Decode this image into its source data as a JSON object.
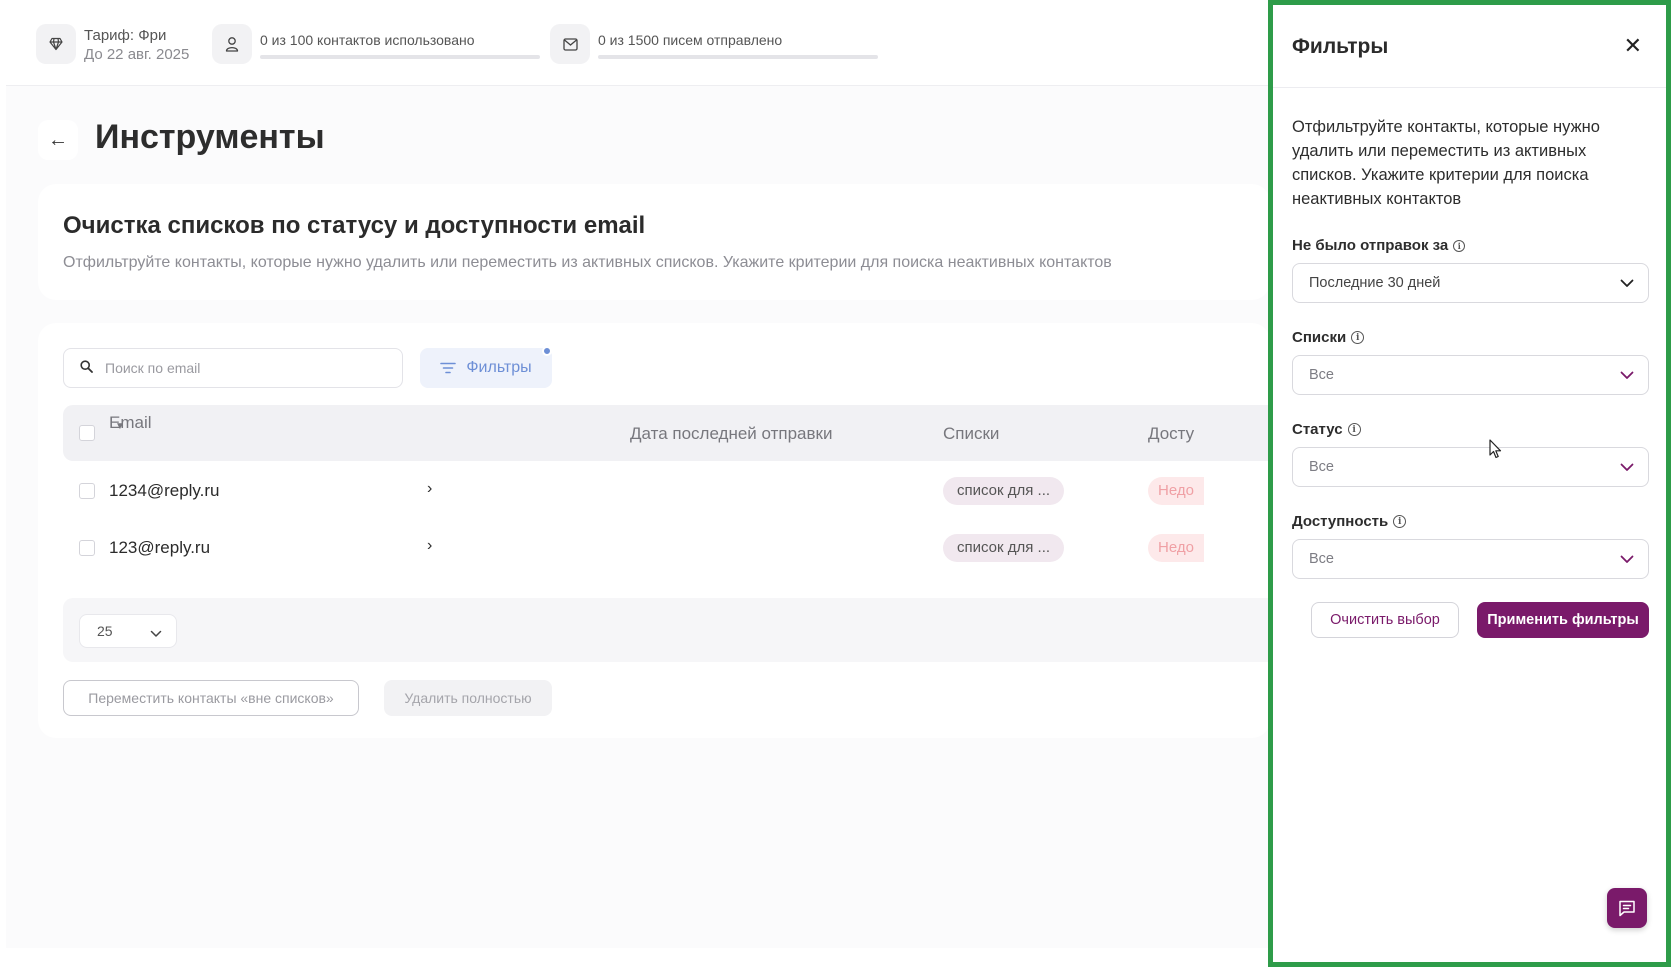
{
  "topbar": {
    "plan_name": "Тариф: Фри",
    "plan_until": "До 22 авг. 2025",
    "contacts_usage": "0 из 100 контактов использовано",
    "contacts_progress": 0,
    "emails_usage": "0 из 1500 писем отправлено",
    "emails_progress": 0
  },
  "page": {
    "title": "Инструменты"
  },
  "info_card": {
    "heading": "Очистка списков по статусу и доступности email",
    "description": "Отфильтруйте контакты, которые нужно удалить или переместить из активных списков. Укажите критерии для поиска неактивных контактов"
  },
  "table": {
    "search_placeholder": "Поиск по email",
    "filters_label": "Фильтры",
    "columns": {
      "email": "Email",
      "last_sent": "Дата последней отправки",
      "lists": "Списки",
      "availability": "Досту"
    },
    "rows": [
      {
        "email": "1234@reply.ru",
        "list": "список для ...",
        "availability": "Недо"
      },
      {
        "email": "123@reply.ru",
        "list": "список для ...",
        "availability": "Недо"
      }
    ],
    "page_size": "25",
    "move_button": "Переместить контакты «вне списков»",
    "delete_button": "Удалить полностью"
  },
  "panel": {
    "title": "Фильтры",
    "description": "Отфильтруйте контакты, которые нужно удалить или переместить из активных списков. Укажите критерии для поиска неактивных контактов",
    "no_sends_label": "Не было отправок за",
    "no_sends_value": "Последние 30 дней",
    "lists_label": "Списки",
    "lists_value": "Все",
    "status_label": "Статус",
    "status_value": "Все",
    "availability_label": "Доступность",
    "availability_value": "Все",
    "clear_button": "Очистить выбор",
    "apply_button": "Применить фильтры"
  },
  "colors": {
    "brand": "#7a1a6a",
    "panel_border": "#2e9c49",
    "filter_accent": "#6d8fd6"
  }
}
